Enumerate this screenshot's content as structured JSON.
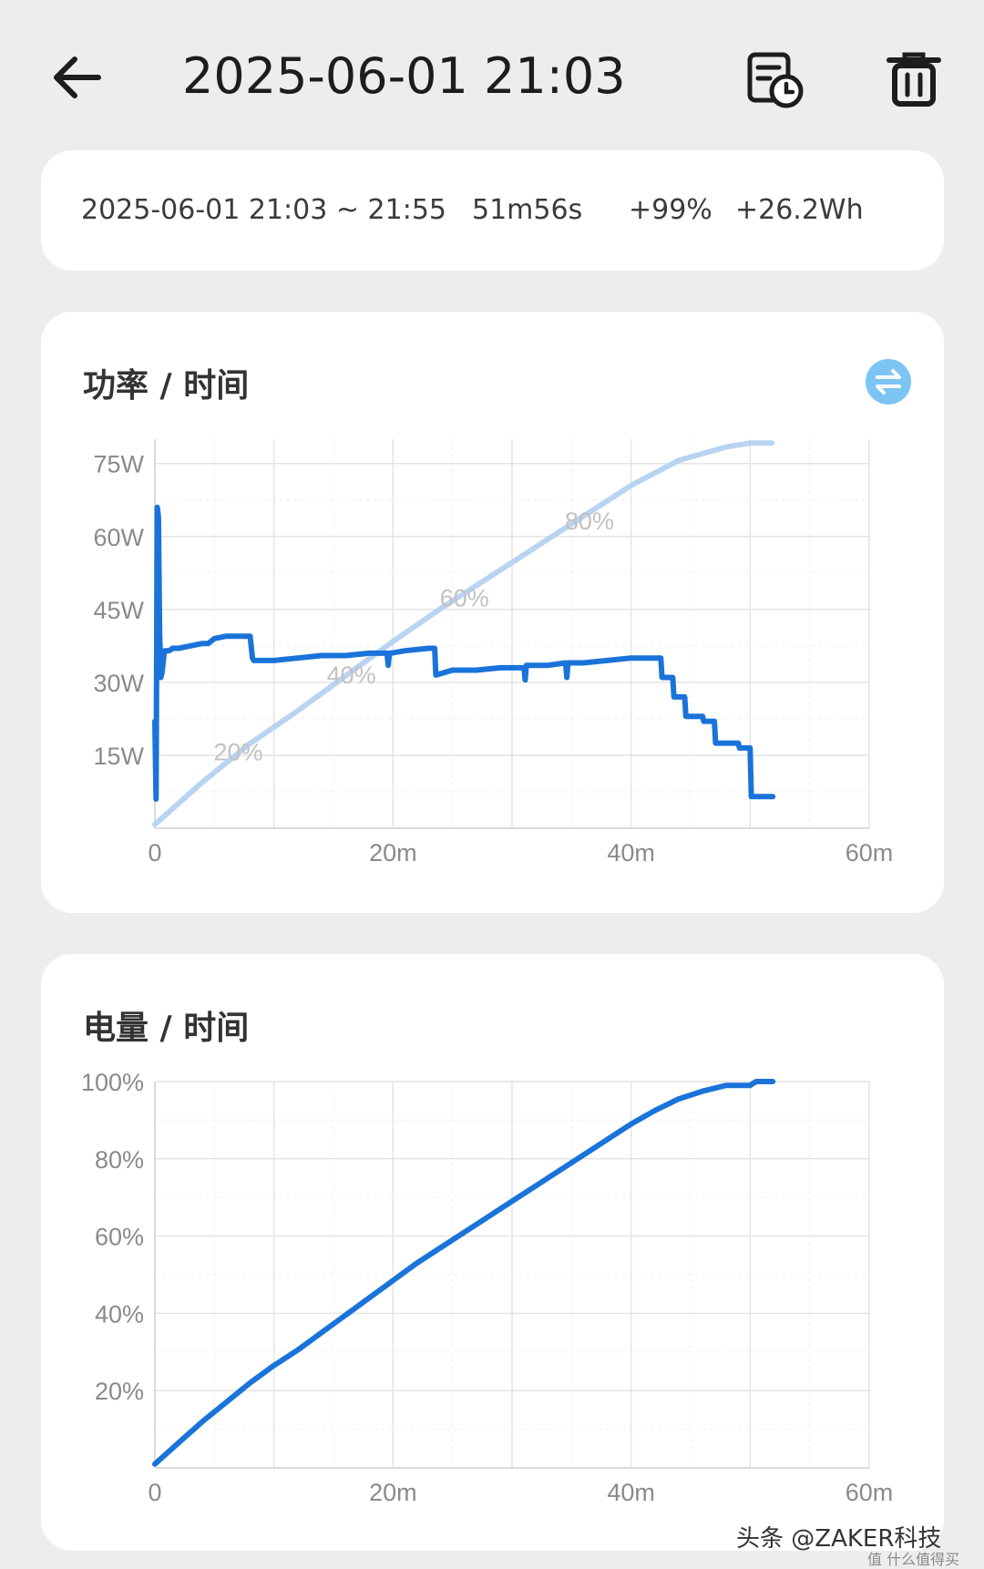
{
  "header": {
    "title": "2025-06-01 21:03"
  },
  "summary": {
    "range": "2025-06-01  21:03 ~ 21:55",
    "duration": "51m56s",
    "percent": "+99%",
    "energy": "+26.2Wh"
  },
  "power_card": {
    "title": "功率 / 时间"
  },
  "battery_card": {
    "title": "电量 / 时间"
  },
  "watermark": {
    "text": "头条 @ZAKER科技",
    "sub": "值 什么值得买"
  },
  "colors": {
    "power_line": "#1a73d9",
    "percent_overlay": "#b9d3f2",
    "battery_line": "#1a73d9",
    "swap_icon": "#7cc4f4"
  },
  "chart_data": [
    {
      "type": "line",
      "title": "功率 / 时间",
      "x_unit": "minutes",
      "xlim": [
        0,
        60
      ],
      "ylim": [
        0,
        80
      ],
      "x_ticks": [
        0,
        20,
        40,
        60
      ],
      "x_tick_labels": [
        "0",
        "20m",
        "40m",
        "60m"
      ],
      "y_ticks": [
        15,
        30,
        45,
        60,
        75
      ],
      "y_tick_labels": [
        "15W",
        "30W",
        "45W",
        "60W",
        "75W"
      ],
      "grid": true,
      "series": [
        {
          "role": "power",
          "x": [
            0,
            0.1,
            0.2,
            0.3,
            0.4,
            0.5,
            0.6,
            0.8,
            1.0,
            1.2,
            1.5,
            2,
            3,
            4,
            4.5,
            5,
            6,
            7,
            8,
            8.2,
            8.3,
            10,
            12,
            14,
            16,
            18,
            19.5,
            19.6,
            19.7,
            19.8,
            21,
            23,
            23.5,
            23.6,
            25,
            27,
            29,
            30,
            31,
            31.1,
            31.2,
            33,
            34.5,
            34.6,
            34.7,
            36,
            38,
            40,
            42,
            42.5,
            42.6,
            43,
            43.5,
            43.6,
            44.5,
            44.6,
            46,
            46.1,
            47,
            47.1,
            49,
            49.1,
            50,
            50.1,
            51.9
          ],
          "y": [
            22,
            6,
            66,
            64,
            40,
            31,
            32,
            36.5,
            36.5,
            36.5,
            37,
            37,
            37.5,
            38,
            38,
            39,
            39.5,
            39.5,
            39.5,
            35,
            34.5,
            34.5,
            35,
            35.5,
            35.5,
            36,
            36,
            33.5,
            36,
            36,
            36.5,
            37,
            37,
            31.5,
            32.5,
            32.5,
            33,
            33,
            33,
            30.5,
            33.5,
            33.5,
            34,
            31,
            34,
            34,
            34.5,
            35,
            35,
            35,
            31,
            31,
            31,
            27,
            27,
            23,
            23,
            22,
            22,
            17.5,
            17.5,
            16.5,
            16.5,
            6.5,
            6.5
          ]
        },
        {
          "role": "battery_percent_overlay",
          "x": [
            0,
            4,
            8,
            12,
            16,
            20,
            24,
            28,
            32,
            36,
            40,
            44,
            48,
            50,
            51.9
          ],
          "y": [
            1,
            12,
            22,
            30.5,
            39.5,
            48.5,
            57,
            65,
            73,
            81,
            89,
            95.5,
            99,
            100,
            100
          ],
          "point_labels": [
            {
              "x": 7,
              "y": 20,
              "label": "20%"
            },
            {
              "x": 16.5,
              "y": 40,
              "label": "40%"
            },
            {
              "x": 26,
              "y": 60,
              "label": "60%"
            },
            {
              "x": 36.5,
              "y": 80,
              "label": "80%"
            }
          ]
        }
      ]
    },
    {
      "type": "line",
      "title": "电量 / 时间",
      "x_unit": "minutes",
      "xlim": [
        0,
        60
      ],
      "ylim": [
        0,
        100
      ],
      "x_ticks": [
        0,
        20,
        40,
        60
      ],
      "x_tick_labels": [
        "0",
        "20m",
        "40m",
        "60m"
      ],
      "y_ticks": [
        20,
        40,
        60,
        80,
        100
      ],
      "y_tick_labels": [
        "20%",
        "40%",
        "60%",
        "80%",
        "100%"
      ],
      "grid": true,
      "series": [
        {
          "role": "battery",
          "x": [
            0,
            2,
            4,
            6,
            8,
            10,
            12,
            14,
            16,
            18,
            20,
            22,
            24,
            26,
            28,
            30,
            32,
            34,
            36,
            38,
            40,
            42,
            44,
            46,
            48,
            49,
            50,
            50.5,
            51,
            51.9
          ],
          "y": [
            1,
            6.5,
            12,
            17,
            22,
            26.5,
            30.5,
            35,
            39.5,
            44,
            48.5,
            53,
            57,
            61,
            65,
            69,
            73,
            77,
            81,
            85,
            89,
            92.5,
            95.5,
            97.5,
            99,
            99,
            99,
            100,
            100,
            100
          ]
        }
      ]
    }
  ]
}
